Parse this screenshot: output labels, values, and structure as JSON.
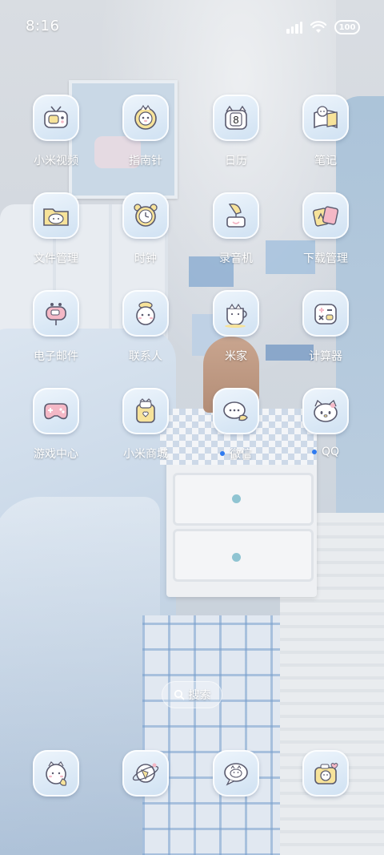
{
  "status_bar": {
    "time": "8:16",
    "battery_level": "100",
    "signal_icon": "signal-icon",
    "wifi_icon": "wifi-icon"
  },
  "apps": [
    {
      "label": "小米视频",
      "icon": "tv-cat-icon",
      "has_dot": false
    },
    {
      "label": "指南针",
      "icon": "compass-cat-icon",
      "has_dot": false
    },
    {
      "label": "日历",
      "icon": "calendar-cat-icon",
      "has_dot": false,
      "badge": "8"
    },
    {
      "label": "笔记",
      "icon": "notebook-cat-icon",
      "has_dot": false
    },
    {
      "label": "文件管理",
      "icon": "folder-cat-icon",
      "has_dot": false
    },
    {
      "label": "时钟",
      "icon": "alarm-clock-icon",
      "has_dot": false
    },
    {
      "label": "录音机",
      "icon": "gramophone-icon",
      "has_dot": false
    },
    {
      "label": "下载管理",
      "icon": "download-cards-icon",
      "has_dot": false
    },
    {
      "label": "电子邮件",
      "icon": "mailbox-icon",
      "has_dot": false
    },
    {
      "label": "联系人",
      "icon": "contact-cat-icon",
      "has_dot": false
    },
    {
      "label": "米家",
      "icon": "cat-cup-icon",
      "has_dot": false
    },
    {
      "label": "计算器",
      "icon": "calculator-icon",
      "has_dot": false
    },
    {
      "label": "游戏中心",
      "icon": "gamepad-icon",
      "has_dot": false
    },
    {
      "label": "小米商城",
      "icon": "shopping-bag-cat-icon",
      "has_dot": false
    },
    {
      "label": "微信",
      "icon": "chat-bubbles-icon",
      "has_dot": true
    },
    {
      "label": "QQ",
      "icon": "kitty-face-icon",
      "has_dot": true
    }
  ],
  "search": {
    "label": "搜索",
    "icon": "search-icon"
  },
  "dock": [
    {
      "icon": "phone-cat-icon"
    },
    {
      "icon": "browser-planet-icon"
    },
    {
      "icon": "message-cat-icon"
    },
    {
      "icon": "camera-cat-icon"
    }
  ],
  "colors": {
    "tile_top": "#eef5fc",
    "tile_bottom": "#cfe1f2",
    "accent_blue": "#2f7bf0",
    "icon_yellow": "#f7e39a",
    "icon_pink": "#f4b8c6"
  }
}
